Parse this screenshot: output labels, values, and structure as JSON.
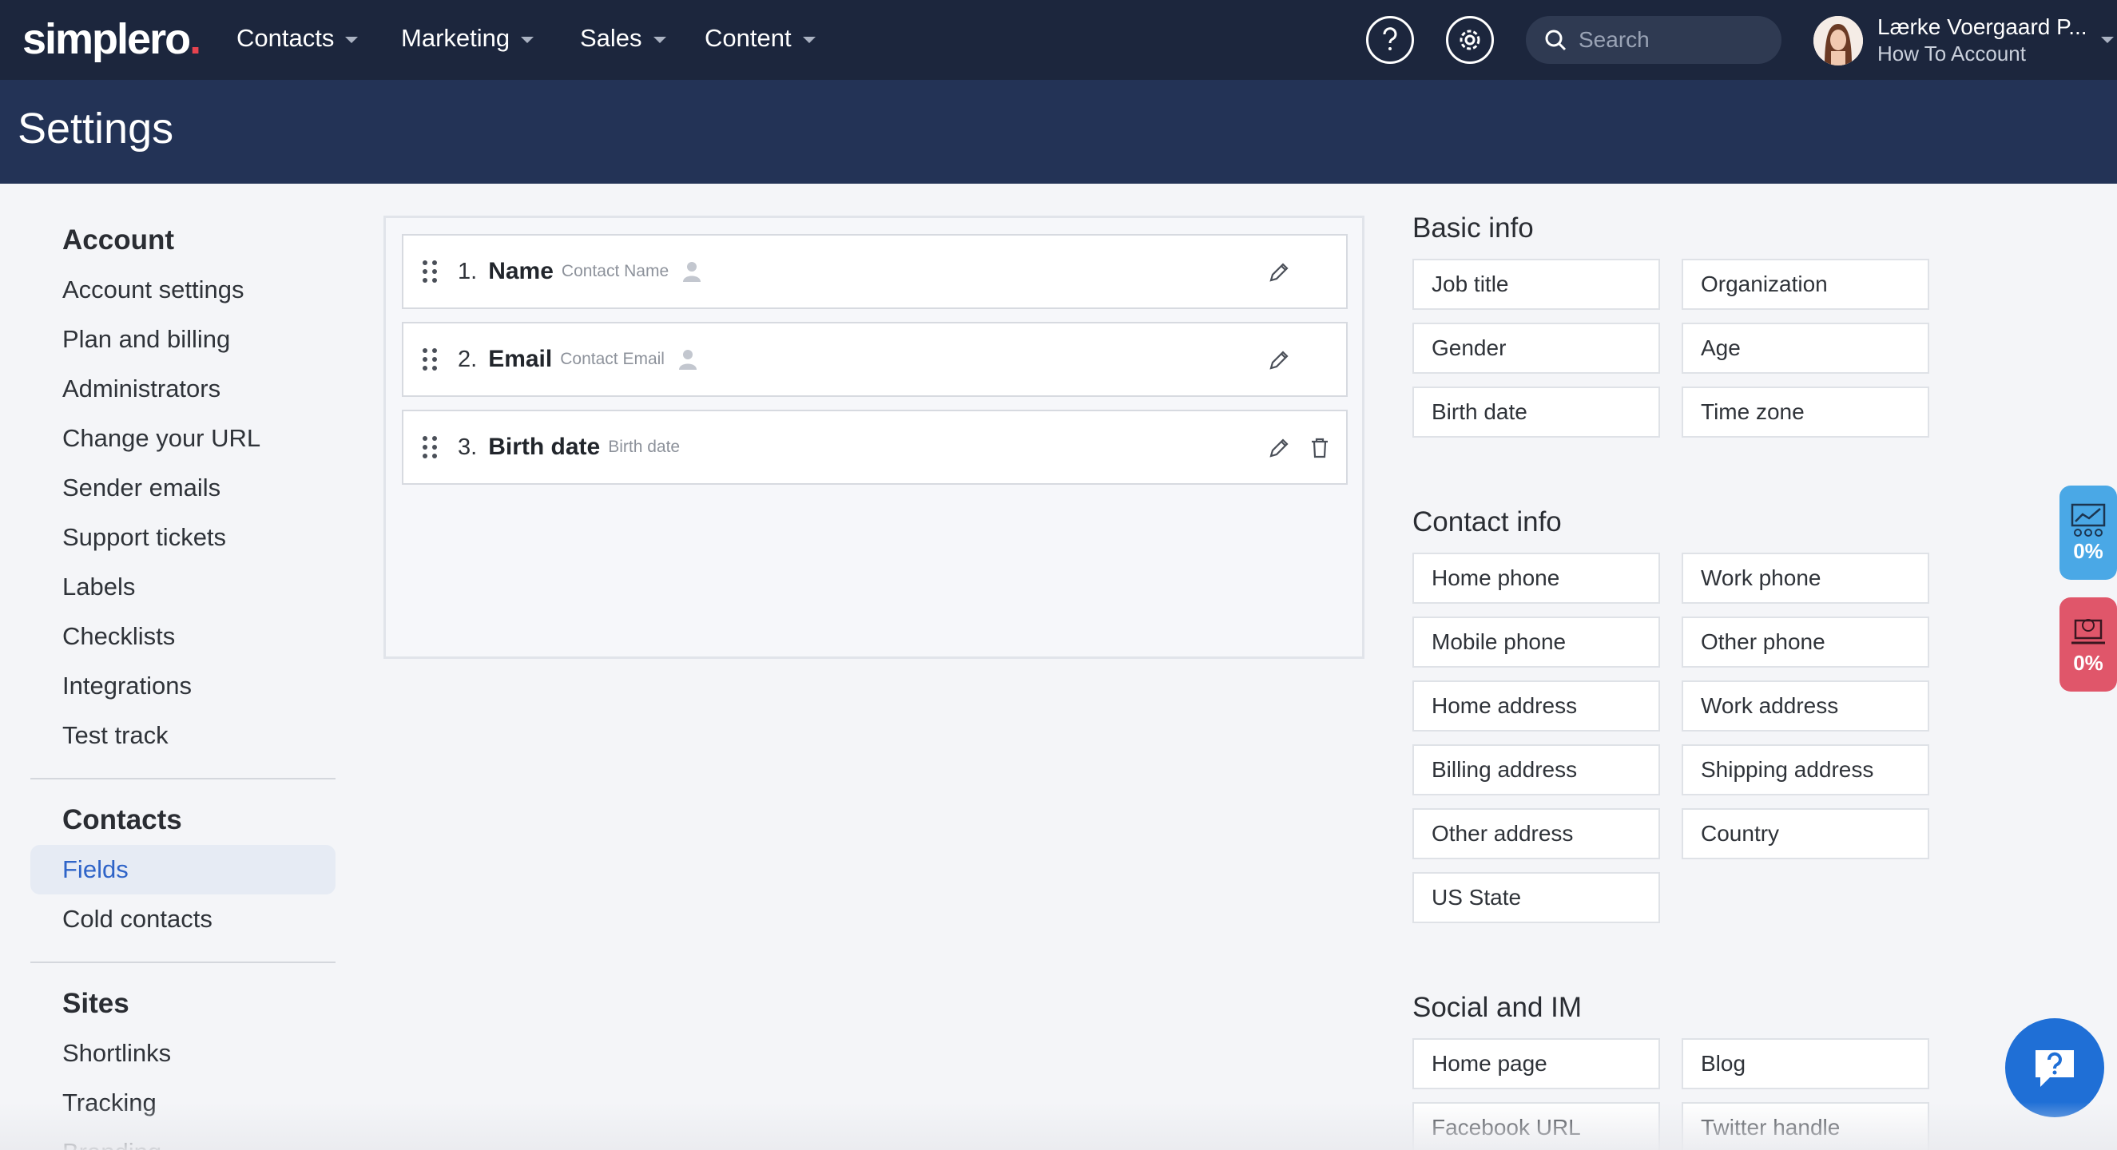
{
  "brand": {
    "logo": "simplero",
    "logo_dot": "."
  },
  "nav": [
    {
      "label": "Contacts"
    },
    {
      "label": "Marketing"
    },
    {
      "label": "Sales"
    },
    {
      "label": "Content"
    }
  ],
  "top": {
    "help_icon": "question-icon",
    "settings_icon": "gear-icon",
    "search_placeholder": "Search",
    "user_name": "Lærke Voergaard P...",
    "user_account": "How To Account"
  },
  "page": {
    "title": "Settings"
  },
  "sidebar": {
    "sections": [
      {
        "title": "Account",
        "items": [
          "Account settings",
          "Plan and billing",
          "Administrators",
          "Change your URL",
          "Sender emails",
          "Support tickets",
          "Labels",
          "Checklists",
          "Integrations",
          "Test track"
        ]
      },
      {
        "title": "Contacts",
        "items": [
          "Fields",
          "Cold contacts"
        ],
        "active": "Fields"
      },
      {
        "title": "Sites",
        "items": [
          "Shortlinks",
          "Tracking",
          "Branding"
        ]
      }
    ]
  },
  "fields": [
    {
      "num": "1.",
      "name": "Name",
      "sub": "Contact Name",
      "system": true,
      "deletable": false
    },
    {
      "num": "2.",
      "name": "Email",
      "sub": "Contact Email",
      "system": true,
      "deletable": false
    },
    {
      "num": "3.",
      "name": "Birth date",
      "sub": "Birth date",
      "system": false,
      "deletable": true
    }
  ],
  "field_groups": [
    {
      "title": "Basic info",
      "items": [
        "Job title",
        "Organization",
        "Gender",
        "Age",
        "Birth date",
        "Time zone"
      ]
    },
    {
      "title": "Contact info",
      "items": [
        "Home phone",
        "Work phone",
        "Mobile phone",
        "Other phone",
        "Home address",
        "Work address",
        "Billing address",
        "Shipping address",
        "Other address",
        "Country",
        "US State"
      ]
    },
    {
      "title": "Social and IM",
      "items": [
        "Home page",
        "Blog",
        "Facebook URL",
        "Twitter handle"
      ]
    }
  ],
  "widgets": [
    {
      "label": "0%",
      "color": "#4aa8e6",
      "icon": "chart-icon"
    },
    {
      "label": "0%",
      "color": "#e0566a",
      "icon": "money-laptop-icon"
    }
  ],
  "colors": {
    "topnav": "#1c263d",
    "header": "#233356",
    "accent": "#2f64c8",
    "help_button": "#1f6fd6"
  }
}
